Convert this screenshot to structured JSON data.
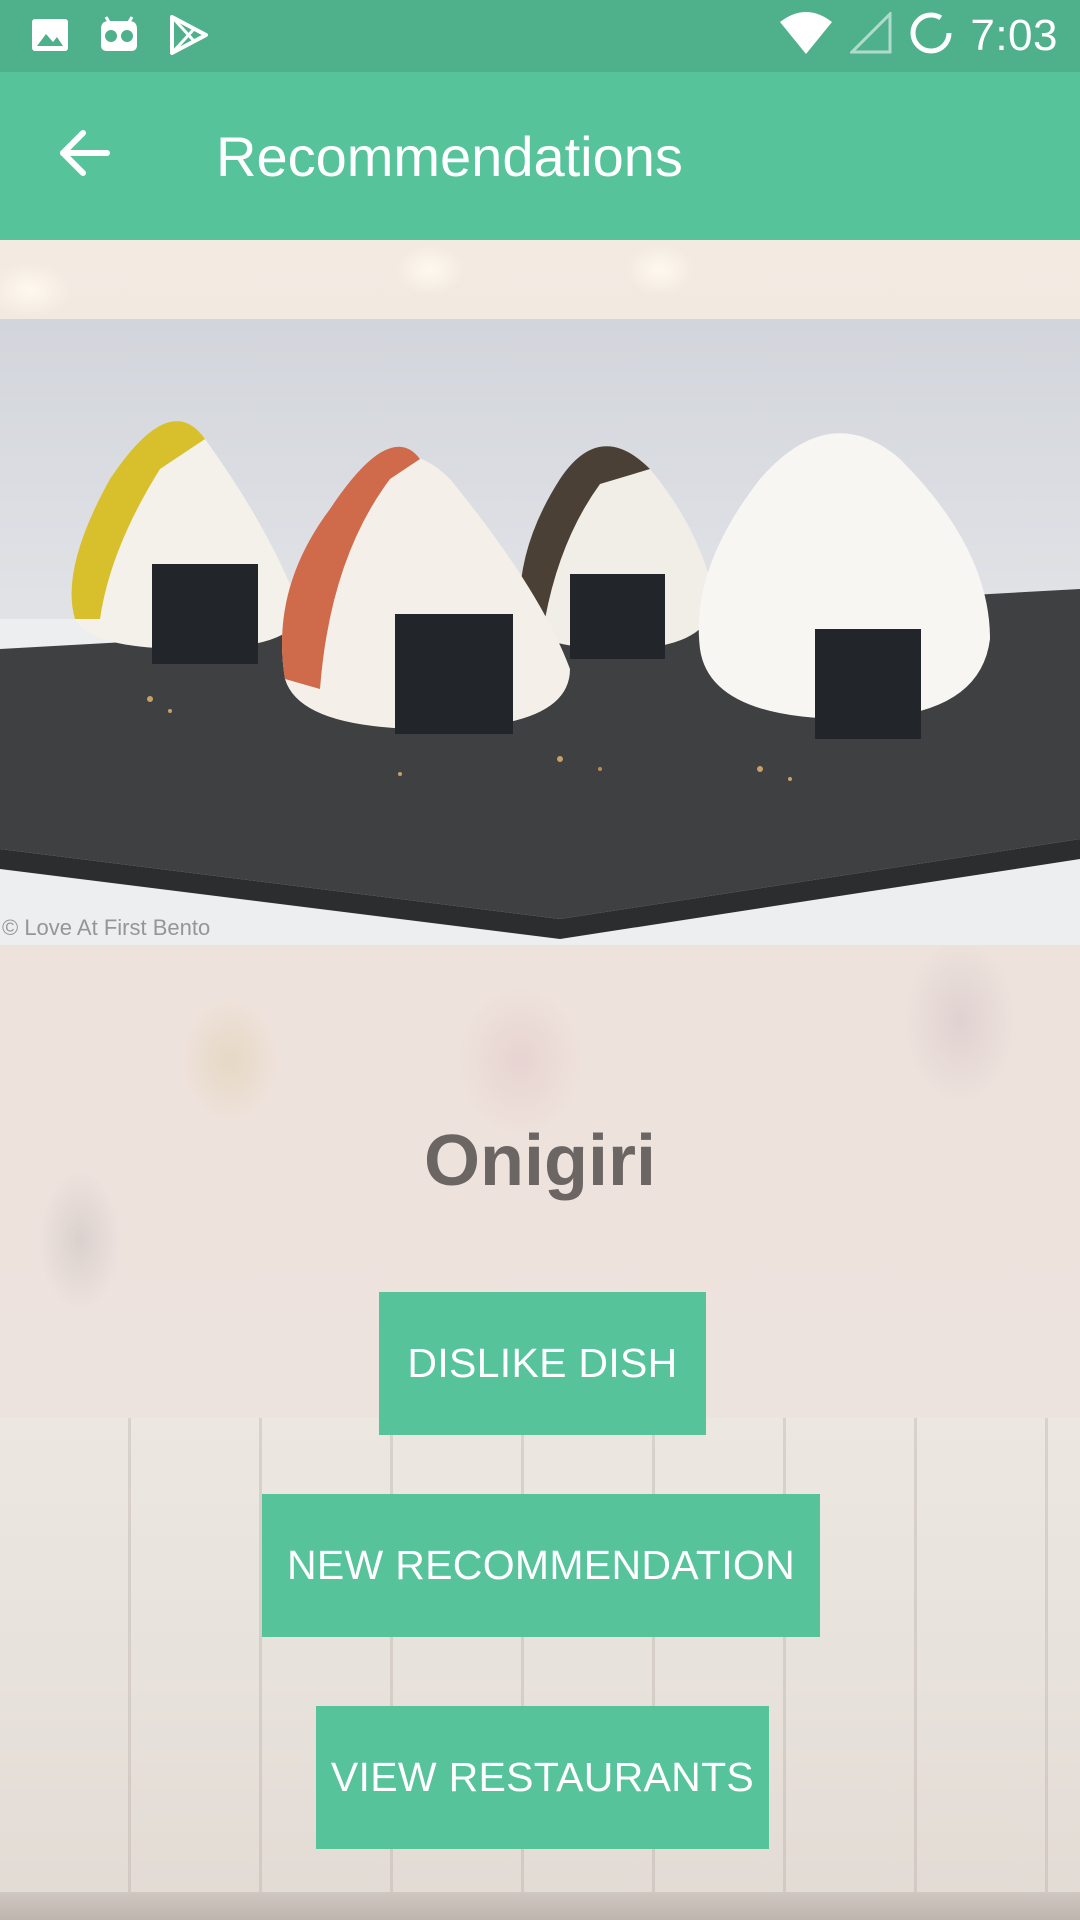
{
  "status_bar": {
    "icons": [
      "image-icon",
      "android-icon",
      "play-store-icon",
      "wifi-icon",
      "cell-signal-icon",
      "sync-icon"
    ],
    "time": "7:03"
  },
  "app_bar": {
    "back_icon": "arrow-left-icon",
    "title": "Recommendations"
  },
  "dish": {
    "photo_credit": "© Love At First Bento",
    "name": "Onigiri"
  },
  "actions": {
    "dislike_label": "DISLIKE DISH",
    "new_label": "NEW RECOMMENDATION",
    "view_label": "VIEW RESTAURANTS"
  },
  "colors": {
    "status_bar": "#4fb08c",
    "app_bar": "#56c39b",
    "button": "#56c39b",
    "dish_name": "#6b6663"
  }
}
